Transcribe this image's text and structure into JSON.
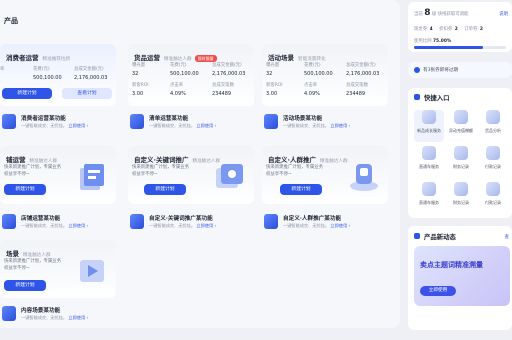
{
  "panel": {
    "title": "产品"
  },
  "cards": {
    "consumer": {
      "title": "消费者运营",
      "tag": "精准推荐拉新",
      "spend_label": "花费(元)",
      "spend": "500,100.00",
      "gmv_label": "总成交金额(元)",
      "gmv": "2,176,000.03",
      "col1_label": "率",
      "new_plan": "新建计划",
      "view_plan": "查看计划"
    },
    "goods": {
      "title": "货品运营",
      "tag": "精准触达人群",
      "hot": "限时限量",
      "m1": "曝光量",
      "m1v": "32",
      "m2": "花费(元)",
      "m2v": "500,100.00",
      "m3": "总成交金额(元)",
      "m3v": "2,176,000.03",
      "m4": "新客ROI",
      "m4v": "3.00",
      "m5": "点击率",
      "m5v": "4.09%",
      "m6": "总成交笔数",
      "m6v": "234489"
    },
    "activity": {
      "title": "活动场景",
      "tag": "智能流量转化",
      "m1": "曝光量",
      "m1v": "32",
      "m2": "花费(元)",
      "m2v": "500,100.00",
      "m3": "总成交金额(元)",
      "m3v": "2,176,000.03",
      "m4": "新客ROI",
      "m4v": "3.00",
      "m5": "点击率",
      "m5v": "4.09%",
      "m6": "总成交笔数",
      "m6v": "234489"
    },
    "shop": {
      "title": "铺运营",
      "tag": "精准触达人群",
      "desc1": "快来新建推广计划，专属业务",
      "desc2": "权益享不停~",
      "btn": "新建计划"
    },
    "custom_kw": {
      "title": "自定义·关键词推广",
      "tag": "精准触达人群",
      "desc1": "快来新建推广计划，专属业务",
      "desc2": "权益享不停~",
      "btn": "新建计划"
    },
    "custom_crowd": {
      "title": "自定义·人群推广",
      "tag": "精准触达人群",
      "desc1": "快来新建推广计划，专属业务",
      "desc2": "权益享不停~",
      "btn": "新建计划"
    },
    "content": {
      "title": "场景",
      "tag": "精准触达人群",
      "desc1": "快来新建推广计划，专属业务",
      "desc2": "权益享不停~",
      "btn": "新建计划"
    }
  },
  "features": {
    "f1": {
      "title": "消费者运营某功能",
      "desc": "一键智能成交、无忧挂。",
      "link": "立即使用 ›"
    },
    "f2": {
      "title": "清单运营某功能",
      "desc": "一键智能成交、无忧挂。",
      "link": "立即使用 ›"
    },
    "f3": {
      "title": "活动场景某功能",
      "desc": "一键智能成交、无忧挂。",
      "link": "立即使用 ›"
    },
    "f4": {
      "title": "店铺运营某功能",
      "desc": "一键智能成交、无忧挂。",
      "link": "立即使用 ›"
    },
    "f5": {
      "title": "自定义·关键词推广某功能",
      "desc": "一键智能成交、无忧挂。",
      "link": "立即使用 ›"
    },
    "f6": {
      "title": "自定义·人群推广某功能",
      "desc": "一键智能成交、无忧挂。",
      "link": "立即使用 ›"
    },
    "f7": {
      "title": "内容场景某功能",
      "desc": "一键智能成交、无忧挂。",
      "link": "立即使用 ›"
    }
  },
  "side": {
    "level_prefix": "当前",
    "level": "8",
    "level_text": "级 快线获取可调能",
    "level_link": "说明",
    "stats": [
      {
        "label": "现金券:",
        "value": "4"
      },
      {
        "label": "折扣券:",
        "value": "2"
      },
      {
        "label": "订单券:",
        "value": "2"
      }
    ],
    "usage_label": "使用比例",
    "usage_value": "75.00%",
    "usage_fraction": 0.75,
    "notice": "有3张券即将过期",
    "quick_title": "快捷入口",
    "quick_items": [
      "新品成长服务",
      "异动充值赠额",
      "货品分析",
      "直通车服务",
      "财务记录",
      "付款记录",
      "直通车服务",
      "财务记录",
      "付款记录"
    ],
    "news_title": "产品新动态",
    "news_more": "查",
    "banner_title": "卖点主题词精准溯量",
    "banner_btn": "立即使用"
  },
  "colors": {
    "brand": "#2e55e8",
    "hot": "#f0504d"
  }
}
